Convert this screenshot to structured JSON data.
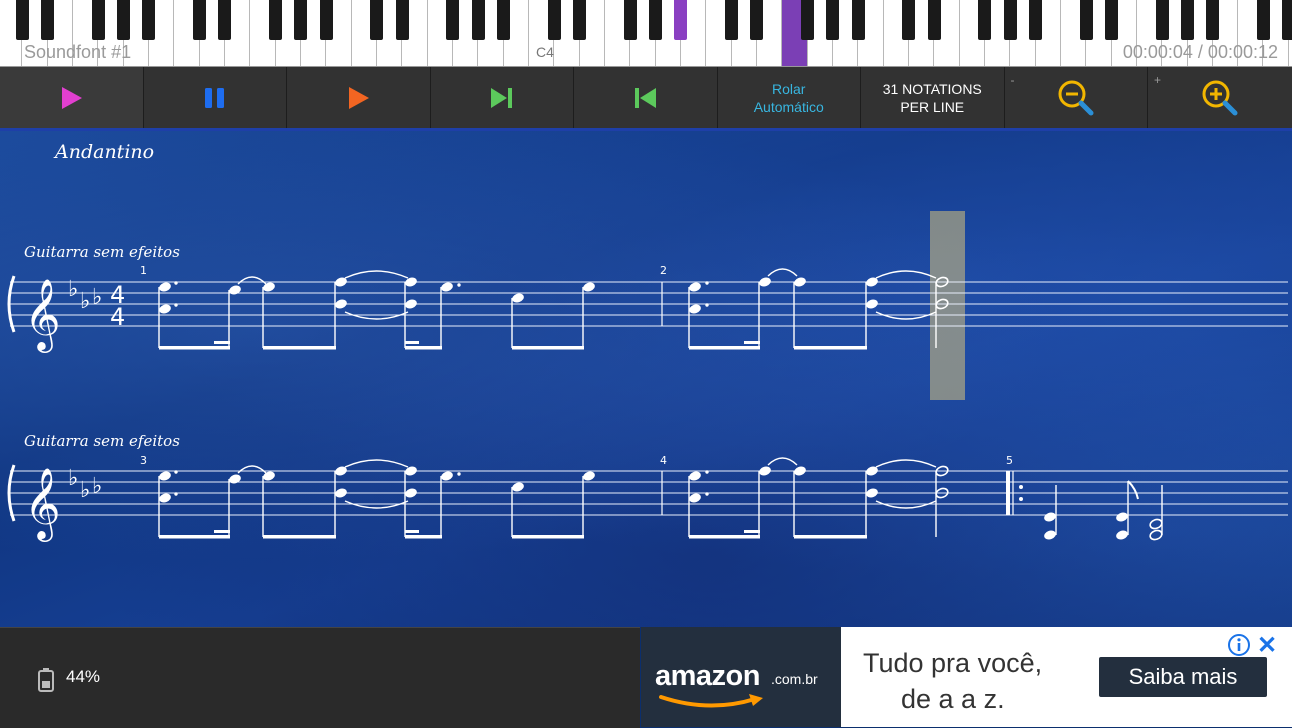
{
  "piano": {
    "soundfont": "Soundfont #1",
    "note_marker": "C4",
    "time": "00:00:04 / 00:00:12"
  },
  "toolbar": {
    "autoscroll_line1": "Rolar",
    "autoscroll_line2": "Automático",
    "notations_line1": "31 NOTATIONS",
    "notations_line2": "PER LINE",
    "zoom_out_sign": "-",
    "zoom_in_sign": "+"
  },
  "score": {
    "tempo": "Andantino",
    "instrument_1": "Guitarra sem efeitos",
    "instrument_2": "Guitarra sem efeitos",
    "measures_row1": [
      "1",
      "2"
    ],
    "measures_row2": [
      "3",
      "4",
      "5"
    ],
    "time_signature": [
      "4",
      "4"
    ]
  },
  "status": {
    "battery": "44%"
  },
  "ad": {
    "brand": "amazon",
    "brand_suffix": ".com.br",
    "headline_line1": "Tudo pra você,",
    "headline_line2": "de a a z.",
    "cta": "Saiba mais"
  },
  "colors": {
    "play": "#e23fd0",
    "pause": "#1e6df0",
    "play_orange": "#f26522",
    "skip": "#5cc95c",
    "zoom": "#f2b600",
    "highlight": "#d9c27a"
  }
}
